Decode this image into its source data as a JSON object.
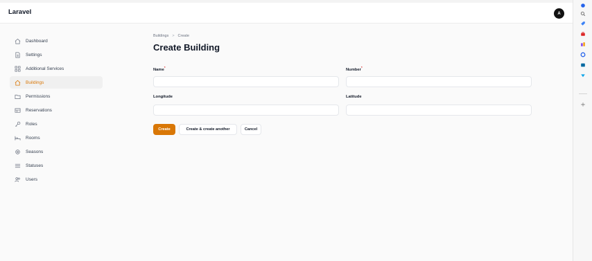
{
  "app": {
    "brand": "Laravel",
    "avatar_initial": "A"
  },
  "sidebar": {
    "items": [
      {
        "label": "Dashboard",
        "icon": "home-icon",
        "active": false
      },
      {
        "label": "Settings",
        "icon": "document-icon",
        "active": false
      },
      {
        "label": "Additional Services",
        "icon": "grid-icon",
        "active": false
      },
      {
        "label": "Buildings",
        "icon": "home-icon",
        "active": true
      },
      {
        "label": "Permissions",
        "icon": "folder-icon",
        "active": false
      },
      {
        "label": "Reservations",
        "icon": "table-icon",
        "active": false
      },
      {
        "label": "Roles",
        "icon": "key-icon",
        "active": false
      },
      {
        "label": "Rooms",
        "icon": "bed-icon",
        "active": false
      },
      {
        "label": "Seasons",
        "icon": "cog-icon",
        "active": false
      },
      {
        "label": "Statuses",
        "icon": "list-icon",
        "active": false
      },
      {
        "label": "Users",
        "icon": "users-icon",
        "active": false
      }
    ]
  },
  "breadcrumb": {
    "parent": "Buildings",
    "separator": ">",
    "current": "Create"
  },
  "page": {
    "title": "Create Building"
  },
  "form": {
    "name_label": "Name",
    "number_label": "Number",
    "longitude_label": "Longitude",
    "latitude_label": "Latitude",
    "required_mark": "*",
    "name_value": "",
    "number_value": "",
    "longitude_value": "",
    "latitude_value": ""
  },
  "actions": {
    "create_label": "Create",
    "create_another_label": "Create & create another",
    "cancel_label": "Cancel"
  },
  "colors": {
    "accent": "#d97706",
    "required": "#dc2626"
  }
}
